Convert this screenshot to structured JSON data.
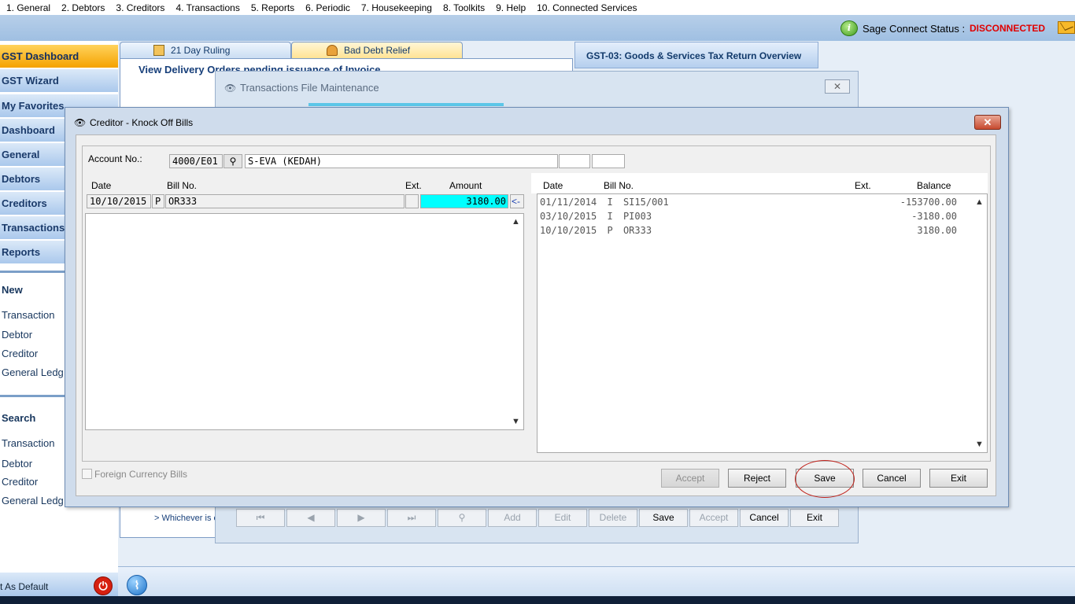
{
  "menu": [
    "1. General",
    "2. Debtors",
    "3. Creditors",
    "4. Transactions",
    "5. Reports",
    "6. Periodic",
    "7. Housekeeping",
    "8. Toolkits",
    "9. Help",
    "10. Connected Services"
  ],
  "status": {
    "label": "Sage Connect Status :",
    "value": "DISCONNECTED",
    "value_color": "#e00000"
  },
  "sidebar": {
    "items": [
      "GST Dashboard",
      "GST Wizard",
      "My Favorites",
      "Dashboard",
      "General",
      "Debtors",
      "Creditors",
      "Transactions",
      "Reports"
    ],
    "new_title": "New",
    "new_links": [
      "Transaction",
      "Debtor",
      "Creditor",
      "General Ledg"
    ],
    "search_title": "Search",
    "search_links": [
      "Transaction",
      "Debtor",
      "Creditor",
      "General Ledg"
    ],
    "set_default": "t As Default"
  },
  "background": {
    "tab_21": "21 Day Ruling",
    "tab_bad_debt": "Bad Debt Relief",
    "tab_gst03": "GST-03: Goods & Services Tax Return Overview",
    "view_delivery": "View Delivery Orders pending issuance of Invoice",
    "whichever": "> Whichever is e"
  },
  "tfm": {
    "title": "Transactions File Maintenance",
    "buttons": [
      "Add",
      "Edit",
      "Delete",
      "Save",
      "Accept",
      "Cancel",
      "Exit"
    ]
  },
  "dialog": {
    "title": "Creditor - Knock Off Bills",
    "account_label": "Account No.:",
    "account_no": "4000/E01",
    "account_name": "S-EVA (KEDAH)",
    "left_headers": {
      "date": "Date",
      "bill": "Bill No.",
      "ext": "Ext.",
      "amount": "Amount"
    },
    "left_row": {
      "date": "10/10/2015",
      "type": "P",
      "bill": "OR333",
      "amount": "3180.00",
      "pointer": "<-"
    },
    "right_headers": {
      "date": "Date",
      "bill": "Bill No.",
      "ext": "Ext.",
      "balance": "Balance"
    },
    "right_rows": [
      {
        "date": "01/11/2014",
        "type": "I",
        "bill": "SI15/001",
        "balance": "-153700.00"
      },
      {
        "date": "03/10/2015",
        "type": "I",
        "bill": "PI003",
        "balance": "-3180.00"
      },
      {
        "date": "10/10/2015",
        "type": "P",
        "bill": "OR333",
        "balance": "3180.00"
      }
    ],
    "foreign_currency": "Foreign Currency Bills",
    "buttons": {
      "accept": "Accept",
      "reject": "Reject",
      "save": "Save",
      "cancel": "Cancel",
      "exit": "Exit"
    },
    "highlight_color": "#00ffff"
  }
}
